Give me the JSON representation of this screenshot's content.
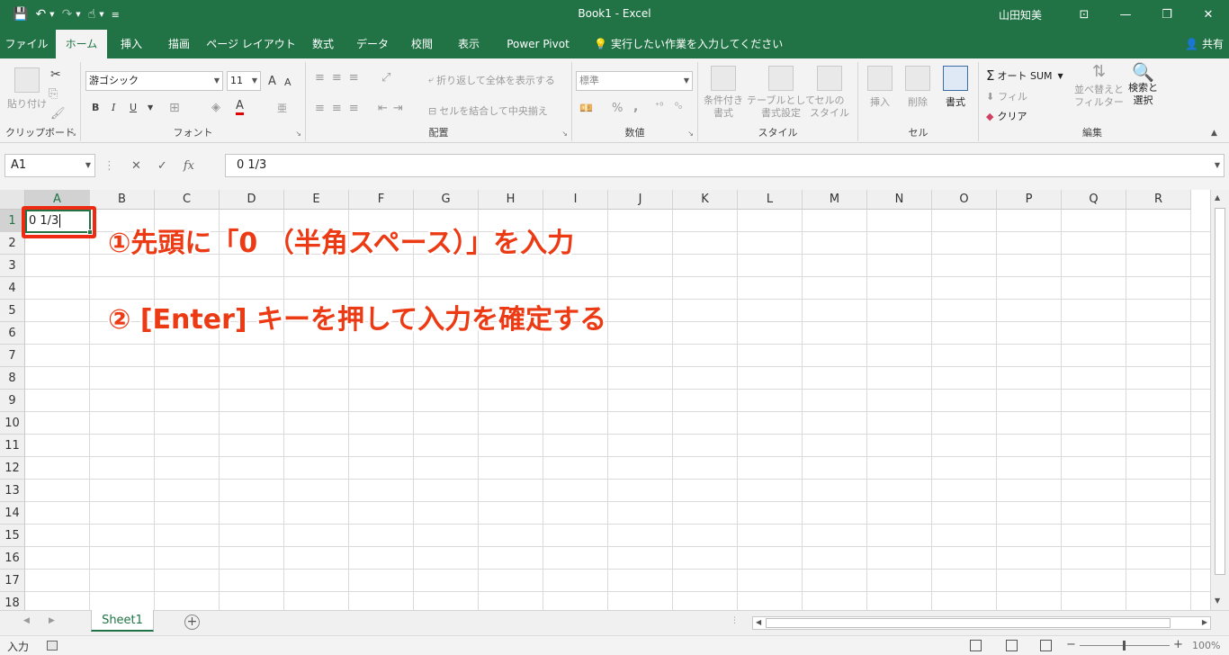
{
  "window": {
    "title": "Book1  -  Excel",
    "user": "山田知美",
    "buttons": {
      "ribbon_display": "⊡",
      "minimize": "—",
      "restore": "❐",
      "close": "✕"
    }
  },
  "qat": {
    "save": "💾",
    "undo": "↶",
    "redo": "↷",
    "touch": "☝",
    "customize": "≡"
  },
  "tabs": [
    "ファイル",
    "ホーム",
    "挿入",
    "描画",
    "ページ レイアウト",
    "数式",
    "データ",
    "校閲",
    "表示",
    "Power Pivot"
  ],
  "tell_me": "実行したい作業を入力してください",
  "share": "共有",
  "ribbon": {
    "clipboard": {
      "label": "クリップボード",
      "paste": "貼り付け"
    },
    "font": {
      "label": "フォント",
      "name": "游ゴシック",
      "size": "11",
      "grow": "A",
      "shrink": "A",
      "bold": "B",
      "italic": "I",
      "underline": "U",
      "phonetic": "亜",
      "font_color_letter": "A"
    },
    "alignment": {
      "label": "配置",
      "wrap": "折り返して全体を表示する",
      "merge": "セルを結合して中央揃え"
    },
    "number": {
      "label": "数値",
      "format": "標準",
      "percent": "%",
      "comma": ","
    },
    "styles": {
      "label": "スタイル",
      "conditional": [
        "条件付き",
        "書式"
      ],
      "table": [
        "テーブルとして",
        "書式設定"
      ],
      "cell": [
        "セルの",
        "スタイル"
      ]
    },
    "cells": {
      "label": "セル",
      "insert": "挿入",
      "delete": "削除",
      "format": "書式"
    },
    "editing": {
      "label": "編集",
      "autosum": "オート SUM",
      "fill": "フィル",
      "clear": "クリア",
      "sort": [
        "並べ替えと",
        "フィルター"
      ],
      "find": [
        "検索と",
        "選択"
      ]
    }
  },
  "formula_bar": {
    "name_box": "A1",
    "cancel": "✕",
    "enter": "✓",
    "fx": "fx",
    "value": "0 1/3"
  },
  "sheet": {
    "columns": [
      "A",
      "B",
      "C",
      "D",
      "E",
      "F",
      "G",
      "H",
      "I",
      "J",
      "K",
      "L",
      "M",
      "N",
      "O",
      "P",
      "Q",
      "R"
    ],
    "rows": [
      "1",
      "2",
      "3",
      "4",
      "5",
      "6",
      "7",
      "8",
      "9",
      "10",
      "11",
      "12",
      "13",
      "14",
      "15",
      "16",
      "17",
      "18"
    ],
    "active_cell": "A1",
    "cell_a1": "0 1/3"
  },
  "annotations": {
    "step1": "①先頭に「0 （半角スペース）」を入力",
    "step2": "② [Enter] キーを押して入力を確定する",
    "highlight_color": "#ee2b12"
  },
  "sheet_tabs": {
    "active": "Sheet1",
    "add": "+"
  },
  "status": {
    "mode": "入力",
    "zoom": "100%"
  },
  "colors": {
    "excel_green": "#217346",
    "ribbon_bg": "#f3f3f3"
  }
}
